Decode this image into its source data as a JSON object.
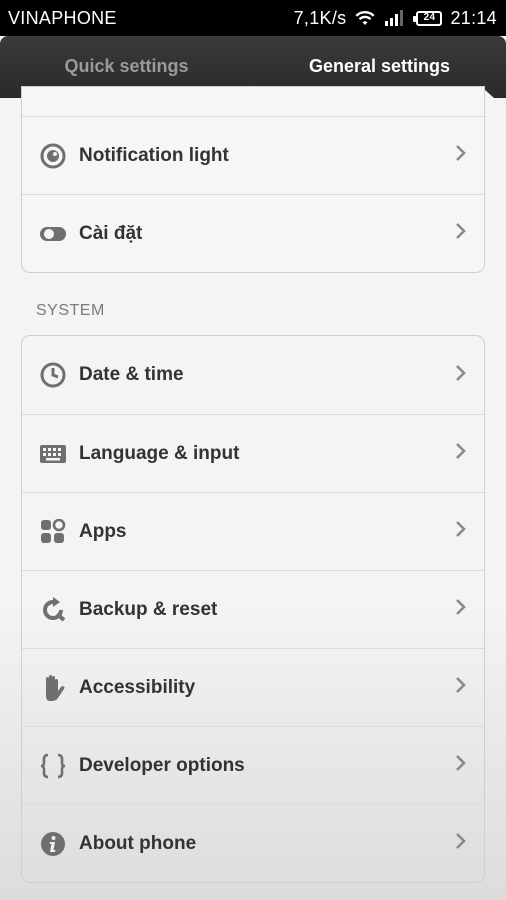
{
  "status_bar": {
    "carrier": "VINAPHONE",
    "net_speed": "7,1K/s",
    "battery_level": "24",
    "time": "21:14",
    "icons": [
      "wifi-icon",
      "signal-icon",
      "battery-icon"
    ]
  },
  "tabs": [
    {
      "label": "Quick settings",
      "active": false
    },
    {
      "label": "General settings",
      "active": true
    }
  ],
  "top_items": [
    {
      "label": "Notification light",
      "icon": "notification-light-icon"
    },
    {
      "label": "Cài đặt",
      "icon": "toggle-icon"
    }
  ],
  "system_section": {
    "header": "SYSTEM",
    "items": [
      {
        "label": "Date & time",
        "icon": "clock-icon"
      },
      {
        "label": "Language & input",
        "icon": "keyboard-icon"
      },
      {
        "label": "Apps",
        "icon": "apps-icon"
      },
      {
        "label": "Backup & reset",
        "icon": "backup-icon"
      },
      {
        "label": "Accessibility",
        "icon": "hand-icon"
      },
      {
        "label": "Developer options",
        "icon": "braces-icon"
      },
      {
        "label": "About phone",
        "icon": "info-icon"
      }
    ]
  },
  "colors": {
    "tab_active": "#ffffff",
    "tab_inactive": "#9a9a9a",
    "label": "#333333",
    "icon": "#6f6f6f",
    "section_header": "#7a7a7a"
  }
}
